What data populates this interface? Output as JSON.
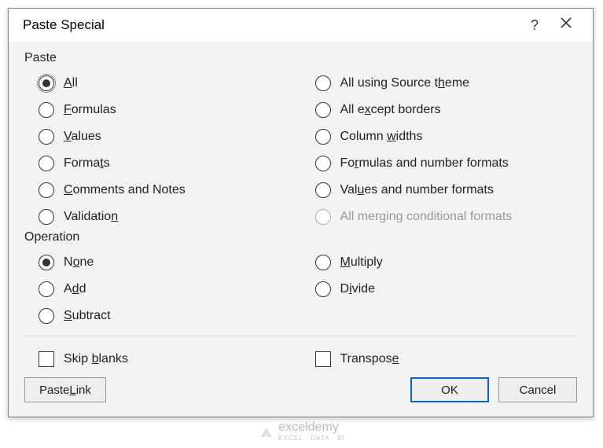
{
  "title": "Paste Special",
  "paste_group_label": "Paste",
  "operation_group_label": "Operation",
  "paste_left": [
    {
      "html": "<u>A</u>ll",
      "selected": true,
      "focused": true
    },
    {
      "html": "<u>F</u>ormulas"
    },
    {
      "html": "<u>V</u>alues"
    },
    {
      "html": "Forma<u>t</u>s"
    },
    {
      "html": "<u>C</u>omments and Notes"
    },
    {
      "html": "Validatio<u>n</u>"
    }
  ],
  "paste_right": [
    {
      "html": "All using Source t<u>h</u>eme"
    },
    {
      "html": "All e<u>x</u>cept borders"
    },
    {
      "html": "Column <u>w</u>idths"
    },
    {
      "html": "Fo<u>r</u>mulas and number formats"
    },
    {
      "html": "Val<u>u</u>es and number formats"
    },
    {
      "html": "All mer<u>g</u>ing conditional formats",
      "disabled": true
    }
  ],
  "op_left": [
    {
      "html": "N<u>o</u>ne",
      "selected": true
    },
    {
      "html": "A<u>d</u>d"
    },
    {
      "html": "<u>S</u>ubtract"
    }
  ],
  "op_right": [
    {
      "html": "<u>M</u>ultiply"
    },
    {
      "html": "D<u>i</u>vide"
    }
  ],
  "skip_blanks_label": "Skip <u>b</u>lanks",
  "transpose_label": "Transpos<u>e</u>",
  "paste_link_label": "Paste <u>L</u>ink",
  "ok_label": "OK",
  "cancel_label": "Cancel",
  "watermark_main": "exceldemy",
  "watermark_sub": "EXCEL · DATA · BI"
}
